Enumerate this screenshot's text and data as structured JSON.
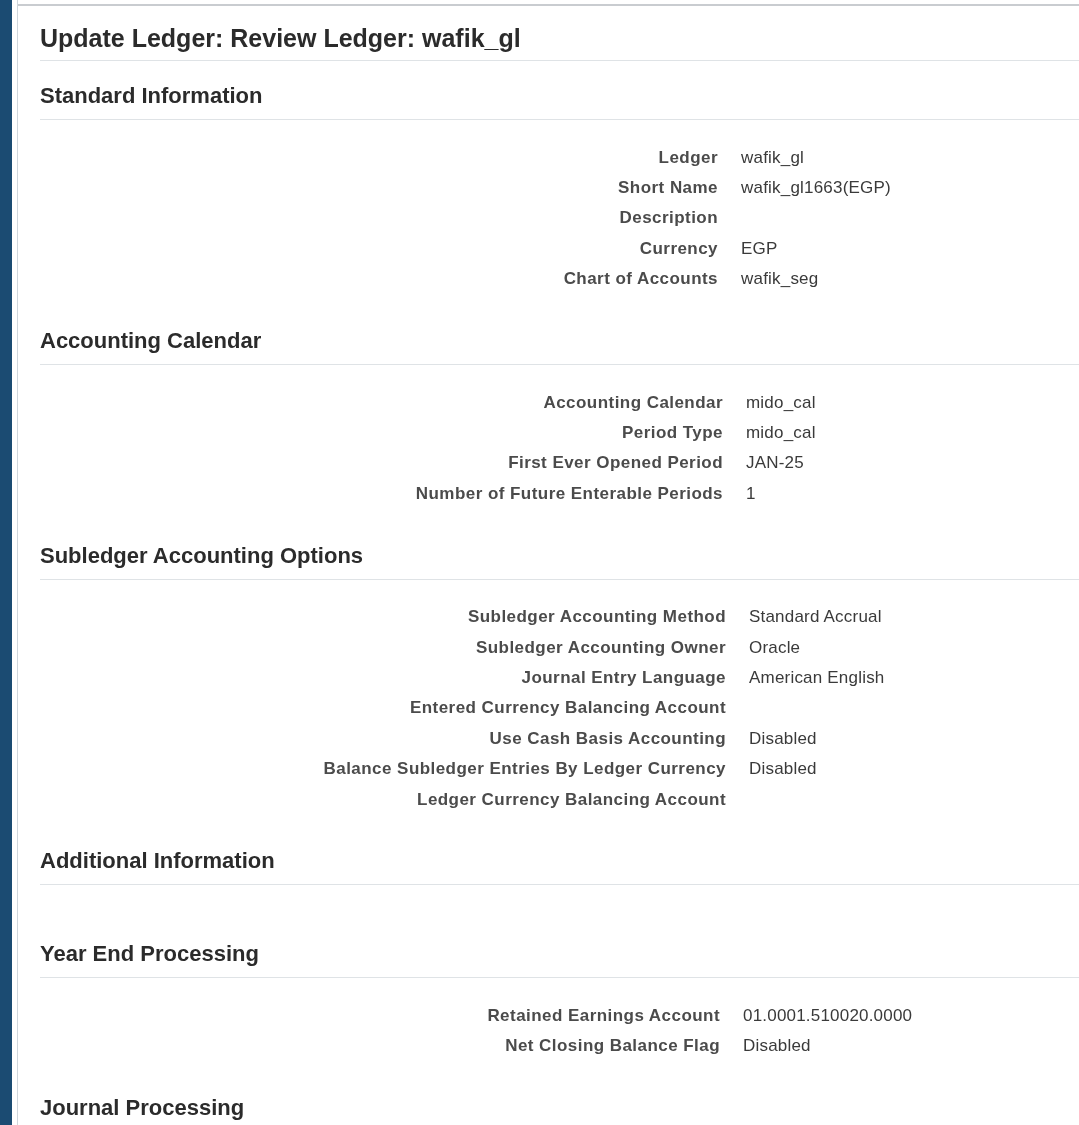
{
  "page": {
    "title": "Update Ledger: Review Ledger: wafik_gl"
  },
  "sections": [
    {
      "title": "Standard Information",
      "fields": [
        {
          "label": "Ledger",
          "value": "wafik_gl"
        },
        {
          "label": "Short Name",
          "value": "wafik_gl1663(EGP)"
        },
        {
          "label": "Description"
        },
        {
          "label": "Currency",
          "value": "EGP"
        },
        {
          "label": "Chart of Accounts",
          "value": "wafik_seg"
        }
      ]
    },
    {
      "title": "Accounting Calendar",
      "fields": [
        {
          "label": "Accounting Calendar",
          "value": "mido_cal"
        },
        {
          "label": "Period Type",
          "value": "mido_cal"
        },
        {
          "label": "First Ever Opened Period",
          "value": "JAN-25"
        },
        {
          "label": "Number of Future Enterable Periods",
          "value": "1"
        }
      ]
    },
    {
      "title": "Subledger Accounting Options",
      "fields": [
        {
          "label": "Subledger Accounting Method",
          "value": "Standard Accrual"
        },
        {
          "label": "Subledger Accounting Owner",
          "value": "Oracle"
        },
        {
          "label": "Journal Entry Language",
          "value": "American English"
        },
        {
          "label": "Entered Currency Balancing Account"
        },
        {
          "label": "Use Cash Basis Accounting",
          "value": "Disabled"
        },
        {
          "label": "Balance Subledger Entries By Ledger Currency",
          "value": "Disabled"
        },
        {
          "label": "Ledger Currency Balancing Account"
        }
      ]
    },
    {
      "title": "Additional Information"
    },
    {
      "title": "Year End Processing",
      "fields": [
        {
          "label": "Retained Earnings Account",
          "value": "01.0001.510020.0000"
        },
        {
          "label": "Net Closing Balance Flag",
          "value": "Disabled"
        }
      ]
    },
    {
      "title": "Journal Processing"
    }
  ]
}
